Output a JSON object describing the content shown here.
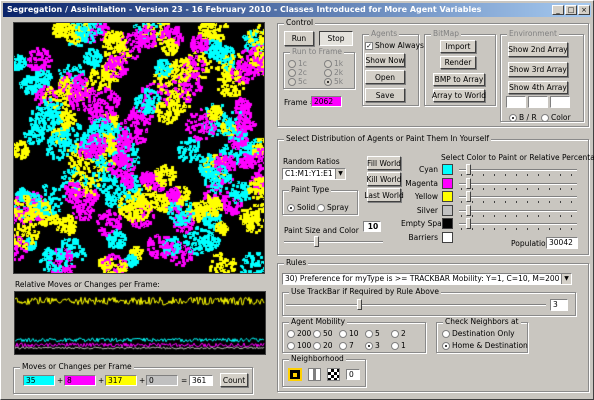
{
  "window": {
    "title": "Segregation / Assimilation - Version 23 - 16 February 2010 - Classes Introduced for More Agent Variables",
    "min": "_",
    "max": "□",
    "close": "×"
  },
  "plot": {
    "title": "Relative Moves or Changes per Frame:"
  },
  "moves": {
    "title": "Moves or Changes per Frame",
    "cyan": "35",
    "magenta": "8",
    "yellow": "317",
    "silver": "0",
    "eq": "=",
    "total": "361",
    "count_btn": "Count",
    "plus": "+"
  },
  "control": {
    "title": "Control",
    "run": "Run",
    "stop": "Stop",
    "run_to_frame": {
      "title": "Run to Frame",
      "options": [
        "1c",
        "2c",
        "5c",
        "1k",
        "2k",
        "5k"
      ],
      "selected": "5k"
    },
    "frame_label": "Frame #",
    "frame_value": "2062"
  },
  "agents": {
    "title": "Agents",
    "show_always": "Show Always",
    "show_now": "Show Now",
    "open": "Open",
    "save": "Save"
  },
  "bitmap": {
    "title": "BitMap",
    "import": "Import",
    "render": "Render",
    "bmp_to_array": "BMP to Array",
    "array_to_world": "Array to World"
  },
  "environment": {
    "title": "Environment",
    "btn2": "Show 2nd Array",
    "btn3": "Show 3rd Array",
    "btn4": "Show 4th Array",
    "bw": "B / R",
    "color": "Color",
    "selected": "B / R"
  },
  "distribution": {
    "title": "Select Distribution of Agents or Paint Them In Yourself",
    "random_ratios": "Random Ratios",
    "ratio_value": "C1:M1:Y1:E1",
    "fill_world": "Fill World",
    "kill_world": "Kill World",
    "last_world": "Last World",
    "paint_type": "Paint Type",
    "solid": "Solid",
    "spray": "Spray",
    "paint_selected": "Solid",
    "paint_size_label": "Paint Size and Color",
    "paint_size": "10",
    "color_title": "Select Color to Paint or Relative Percentages",
    "colors": [
      {
        "label": "Cyan",
        "hex": "#00ffff",
        "level": 0.06
      },
      {
        "label": "Magenta",
        "hex": "#ff00ff",
        "level": 0.06
      },
      {
        "label": "Yellow",
        "hex": "#ffff00",
        "level": 0.06
      },
      {
        "label": "Silver",
        "hex": "#c0c0c0",
        "level": 0.06
      },
      {
        "label": "Empty Space",
        "hex": "#000000",
        "level": 0.06
      },
      {
        "label": "Barriers",
        "hex": "#ffffff",
        "level": null
      }
    ],
    "population_label": "Population",
    "population": "30042"
  },
  "rules": {
    "title": "Rules",
    "rule": "30) Preference for myType is >= TRACKBAR Mobility: Y=1, C=10, M=200",
    "trackbar_label": "Use TrackBar if Required by Rule Above",
    "trackbar_value": "3",
    "trackbar_level": 0.28
  },
  "mobility": {
    "title": "Agent Mobility",
    "options": [
      "200",
      "50",
      "10",
      "5",
      "2",
      "100",
      "20",
      "7",
      "3",
      "1"
    ],
    "selected": "3"
  },
  "neighbors": {
    "title": "Check Neighbors at",
    "dest_only": "Destination Only",
    "home_dest": "Home & Destination",
    "selected": "Home & Destination"
  },
  "neighborhood": {
    "title": "Neighborhood",
    "value": "0"
  },
  "colors": {
    "cyan": "#00ffff",
    "magenta": "#ff00ff",
    "yellow": "#ffff00",
    "silver": "#c0c0c0",
    "frame_bg": "#ff00ff"
  }
}
